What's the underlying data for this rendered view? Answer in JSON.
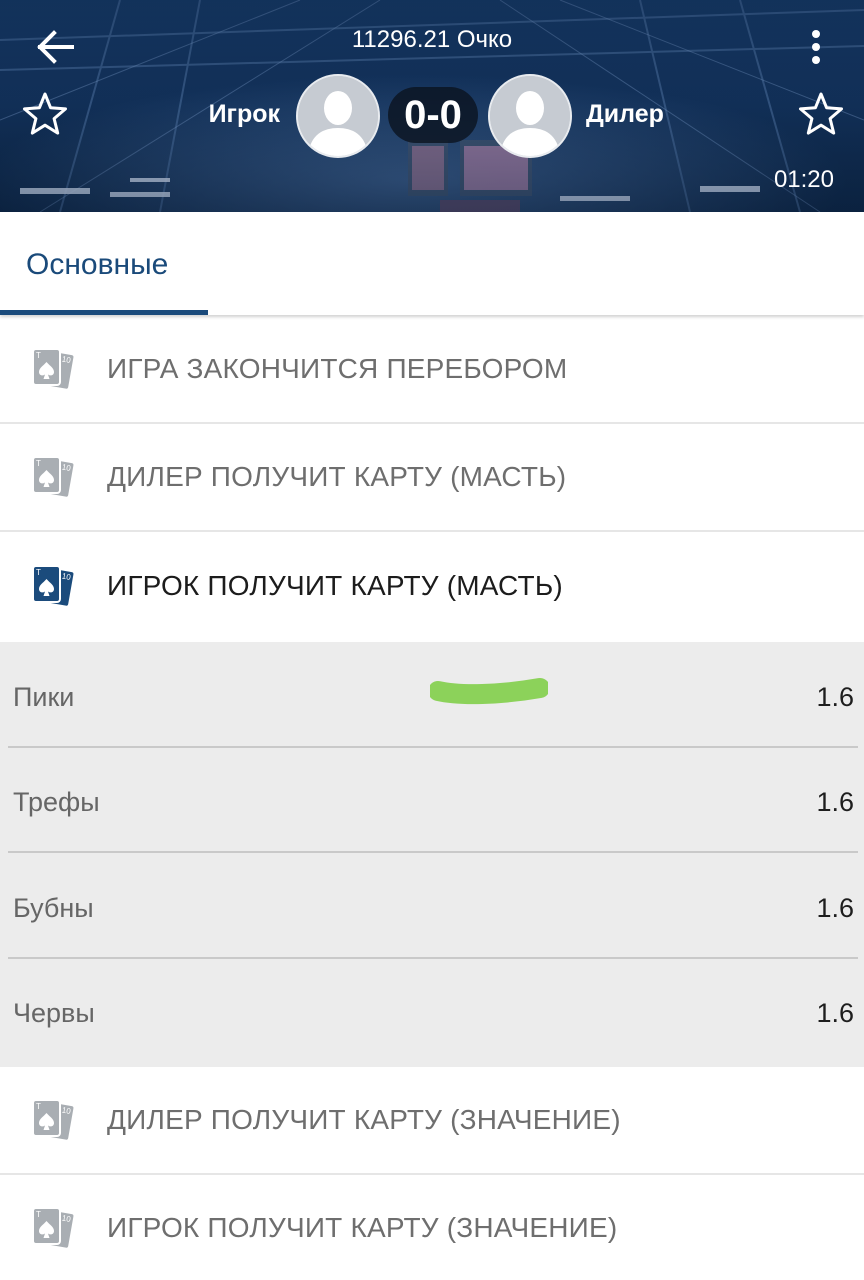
{
  "header": {
    "title": "11296.21 Очко",
    "player_left": "Игрок",
    "player_right": "Дилер",
    "score": "0-0",
    "timer": "01:20"
  },
  "tabs": [
    {
      "label": "Основные",
      "selected": true
    }
  ],
  "markets_top": [
    {
      "label": "ИГРА ЗАКОНЧИТСЯ ПЕРЕБОРОМ",
      "expanded": false
    },
    {
      "label": "ДИЛЕР ПОЛУЧИТ КАРТУ (МАСТЬ)",
      "expanded": false
    },
    {
      "label": "ИГРОК ПОЛУЧИТ КАРТУ (МАСТЬ)",
      "expanded": true
    }
  ],
  "outcomes": [
    {
      "name": "Пики",
      "odds": "1.6"
    },
    {
      "name": "Трефы",
      "odds": "1.6"
    },
    {
      "name": "Бубны",
      "odds": "1.6"
    },
    {
      "name": "Червы",
      "odds": "1.6"
    }
  ],
  "markets_bottom": [
    {
      "label": "ДИЛЕР ПОЛУЧИТ КАРТУ (ЗНАЧЕНИЕ)",
      "expanded": false
    },
    {
      "label": "ИГРОК ПОЛУЧИТ КАРТУ (ЗНАЧЕНИЕ)",
      "expanded": false
    }
  ],
  "icons": {
    "back": "arrow-left-icon",
    "menu": "more-vertical-icon",
    "favorite": "star-outline-icon",
    "avatar": "user-avatar-icon",
    "market": "playing-cards-icon"
  },
  "colors": {
    "accent": "#1b4b7c",
    "icon_inactive": "#a9aeb3",
    "icon_active": "#1b4b7c",
    "outcome_bg": "#ececec",
    "green_mark": "#8cd25a"
  },
  "card_icon": {
    "rank_back": "T",
    "rank_front": "10"
  }
}
